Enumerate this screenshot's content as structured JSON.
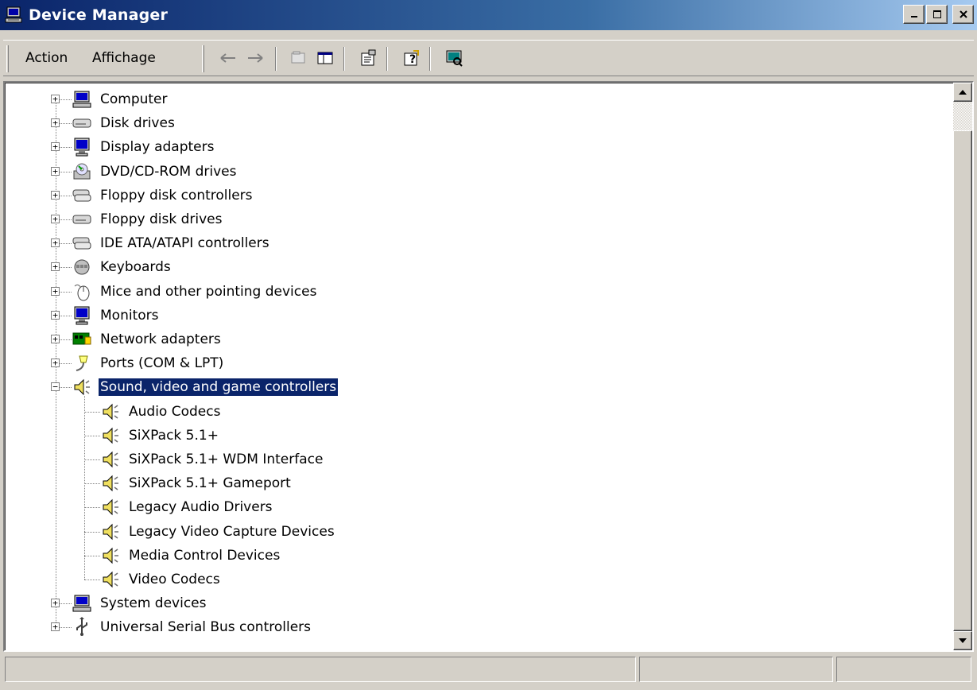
{
  "window": {
    "title": "Device Manager",
    "accent": "#0a246a"
  },
  "menu": {
    "action": "Action",
    "view": "Affichage"
  },
  "toolbar": {
    "icons": [
      "back-icon",
      "forward-icon",
      "up-icon",
      "show-hide-console-tree-icon",
      "properties-icon",
      "help-icon",
      "scan-hardware-icon"
    ]
  },
  "tree": {
    "items": [
      {
        "label": "Computer",
        "icon": "computer-icon",
        "state": "collapsed"
      },
      {
        "label": "Disk drives",
        "icon": "disk-drive-icon",
        "state": "collapsed"
      },
      {
        "label": "Display adapters",
        "icon": "display-adapter-icon",
        "state": "collapsed"
      },
      {
        "label": "DVD/CD-ROM drives",
        "icon": "cdrom-icon",
        "state": "collapsed"
      },
      {
        "label": "Floppy disk controllers",
        "icon": "controller-icon",
        "state": "collapsed"
      },
      {
        "label": "Floppy disk drives",
        "icon": "floppy-drive-icon",
        "state": "collapsed"
      },
      {
        "label": "IDE ATA/ATAPI controllers",
        "icon": "controller-icon",
        "state": "collapsed"
      },
      {
        "label": "Keyboards",
        "icon": "keyboard-icon",
        "state": "collapsed"
      },
      {
        "label": "Mice and other pointing devices",
        "icon": "mouse-icon",
        "state": "collapsed"
      },
      {
        "label": "Monitors",
        "icon": "monitor-icon",
        "state": "collapsed"
      },
      {
        "label": "Network adapters",
        "icon": "network-adapter-icon",
        "state": "collapsed"
      },
      {
        "label": "Ports (COM & LPT)",
        "icon": "port-icon",
        "state": "collapsed"
      },
      {
        "label": "Sound, video and game controllers",
        "icon": "speaker-icon",
        "state": "expanded",
        "selected": true
      },
      {
        "label": "System devices",
        "icon": "computer-icon",
        "state": "collapsed"
      },
      {
        "label": "Universal Serial Bus controllers",
        "icon": "usb-icon",
        "state": "collapsed"
      }
    ],
    "sound_children": [
      "Audio Codecs",
      "SiXPack 5.1+",
      "SiXPack 5.1+ WDM Interface",
      "SiXPack 5.1+ Gameport",
      "Legacy Audio Drivers",
      "Legacy Video Capture Devices",
      "Media Control Devices",
      "Video Codecs"
    ]
  },
  "statusbar": {
    "panes": [
      "",
      "",
      ""
    ]
  }
}
